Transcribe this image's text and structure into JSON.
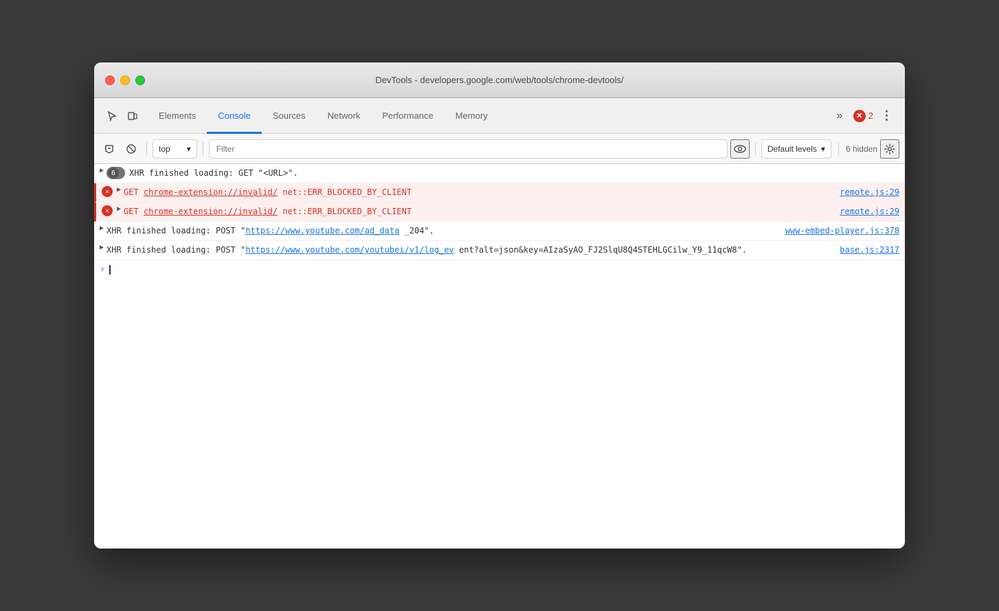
{
  "window": {
    "title": "DevTools - developers.google.com/web/tools/chrome-devtools/"
  },
  "tabs": {
    "items": [
      {
        "label": "Elements",
        "active": false
      },
      {
        "label": "Console",
        "active": true
      },
      {
        "label": "Sources",
        "active": false
      },
      {
        "label": "Network",
        "active": false
      },
      {
        "label": "Performance",
        "active": false
      },
      {
        "label": "Memory",
        "active": false
      }
    ]
  },
  "error_badge": {
    "count": "2"
  },
  "console_toolbar": {
    "context": "top",
    "filter_placeholder": "Filter",
    "levels_label": "Default levels",
    "hidden_label": "6 hidden"
  },
  "console_entries": [
    {
      "type": "xhr_group",
      "badge_count": "6",
      "text": "XHR finished loading: GET \"<URL>\"."
    },
    {
      "type": "error",
      "method": "GET",
      "url": "chrome-extension://invalid/",
      "error_code": "net::ERR_BLOCKED_BY_CLIENT",
      "source": "remote.js:29"
    },
    {
      "type": "error",
      "method": "GET",
      "url": "chrome-extension://invalid/",
      "error_code": "net::ERR_BLOCKED_BY_CLIENT",
      "source": "remote.js:29"
    },
    {
      "type": "xhr",
      "text_before": "XHR finished loading: POST \"",
      "url": "https://www.youtube.com/ad_data",
      "text_after": " www-embed-player.js:378",
      "source": "www-embed-player.js:378",
      "source2": "_204\""
    },
    {
      "type": "xhr2",
      "text_before": "XHR finished loading: POST \"",
      "url": "https://www.youtube.com/youtubei/v1/log_ev",
      "source": "base.js:2317",
      "text_after": "ent?alt=json&key=AIzaSyAO_FJ2SlqU8Q4STEHLGCilw_Y9_11qcW8\"."
    }
  ]
}
